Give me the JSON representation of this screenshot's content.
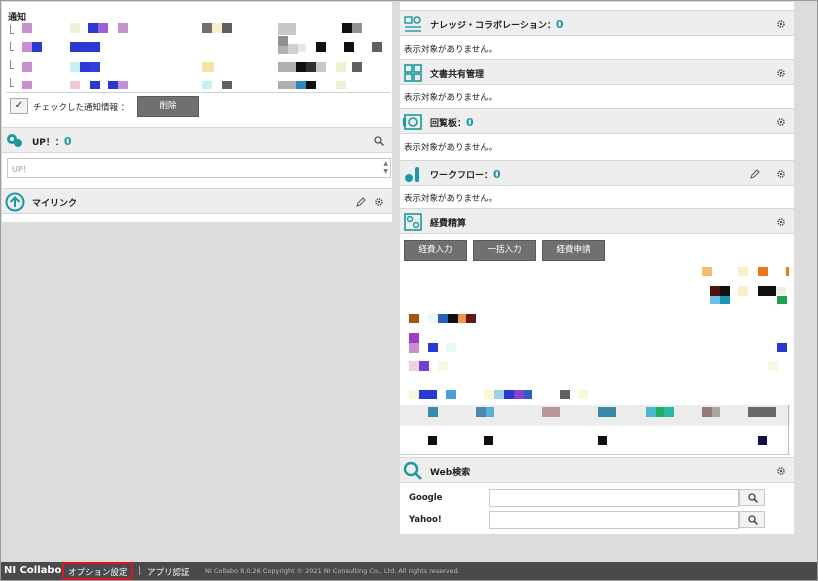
{
  "notice": {
    "title": "通知",
    "check_label": "チェックした通知情報 ：",
    "delete_button": "削除",
    "check_mark": "✓"
  },
  "up": {
    "title": "UP！：",
    "count": "0",
    "placeholder": "UP！"
  },
  "mylink": {
    "title": "マイリンク"
  },
  "knowledge": {
    "title": "ナレッジ・コラボレーション：",
    "count": "0",
    "empty": "表示対象がありません。"
  },
  "docshare": {
    "title": "文書共有管理",
    "empty": "表示対象がありません。"
  },
  "circular": {
    "title": "回覧板：",
    "count": "0",
    "empty": "表示対象がありません。"
  },
  "workflow": {
    "title": "ワークフロー：",
    "count": "0",
    "empty": "表示対象がありません。"
  },
  "expense": {
    "title": "経費精算",
    "buttons": [
      "経費入力",
      "一括入力",
      "経費申請"
    ]
  },
  "websearch": {
    "title": "Web検索",
    "engines": [
      "Google",
      "Yahoo!"
    ]
  },
  "footer": {
    "logo": "NI Collabo",
    "option_settings": "オプション設定",
    "separator": "|",
    "app_auth": "アプリ認証",
    "copyright": "NI Collabo 8.0.26 Copyright © 2021 NI Consulting Co., Ltd. All rights reserved."
  },
  "colors": {
    "teal": "#1a9aa0",
    "highlight_red": "#e0141e"
  },
  "icons": [
    "knowledge-icon",
    "document-share-icon",
    "circular-board-icon",
    "workflow-icon",
    "expense-icon",
    "web-search-icon",
    "up-icon",
    "mylink-arrow-icon",
    "gear-icon",
    "pencil-icon",
    "search-icon"
  ]
}
